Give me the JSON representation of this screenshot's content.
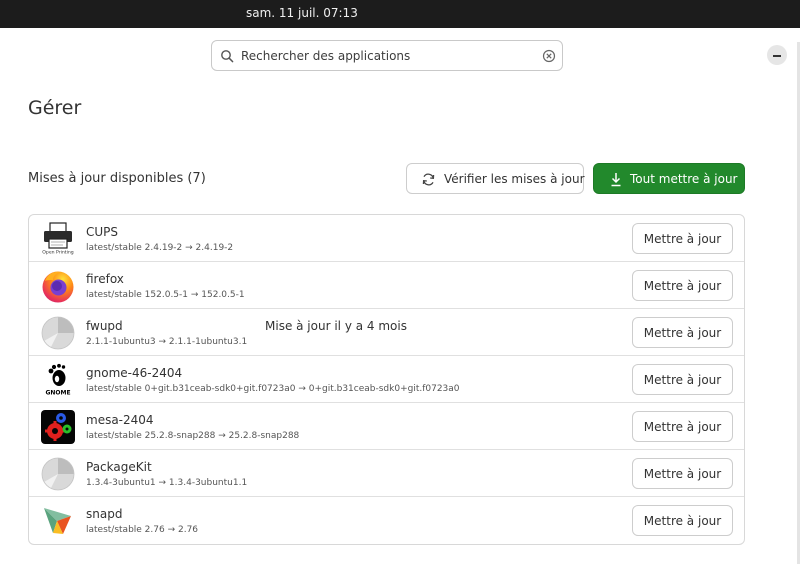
{
  "topbar": {
    "clock": "sam. 11 juil.  07:13"
  },
  "search": {
    "placeholder": "Rechercher des applications"
  },
  "page": {
    "title": "Gérer"
  },
  "updates": {
    "heading": "Mises à jour disponibles (7)",
    "check_label": "Vérifier les mises à jour",
    "update_all_label": "Tout mettre à jour",
    "accent_color": "#22892c",
    "items": [
      {
        "name": "CUPS",
        "version": "latest/stable 2.4.19-2 → 2.4.19-2",
        "note": "",
        "icon": "cups-openprinting-icon",
        "button": "Mettre à jour",
        "icon_text": "Open Printing"
      },
      {
        "name": "firefox",
        "version": "latest/stable 152.0.5-1 → 152.0.5-1",
        "note": "",
        "icon": "firefox-icon",
        "button": "Mettre à jour"
      },
      {
        "name": "fwupd",
        "version": "2.1.1-1ubuntu3 → 2.1.1-1ubuntu3.1",
        "note": "Mise à jour il y a 4 mois",
        "icon": "generic-package-icon",
        "button": "Mettre à jour"
      },
      {
        "name": "gnome-46-2404",
        "version": "latest/stable 0+git.b31ceab-sdk0+git.f0723a0 → 0+git.b31ceab-sdk0+git.f0723a0",
        "note": "",
        "icon": "gnome-foot-icon",
        "button": "Mettre à jour",
        "icon_text": "GNOME"
      },
      {
        "name": "mesa-2404",
        "version": "latest/stable 25.2.8-snap288 → 25.2.8-snap288",
        "note": "",
        "icon": "mesa-gears-icon",
        "button": "Mettre à jour"
      },
      {
        "name": "PackageKit",
        "version": "1.3.4-3ubuntu1 → 1.3.4-3ubuntu1.1",
        "note": "",
        "icon": "generic-package-icon",
        "button": "Mettre à jour"
      },
      {
        "name": "snapd",
        "version": "latest/stable 2.76 → 2.76",
        "note": "",
        "icon": "snapcraft-bird-icon",
        "button": "Mettre à jour"
      }
    ]
  }
}
